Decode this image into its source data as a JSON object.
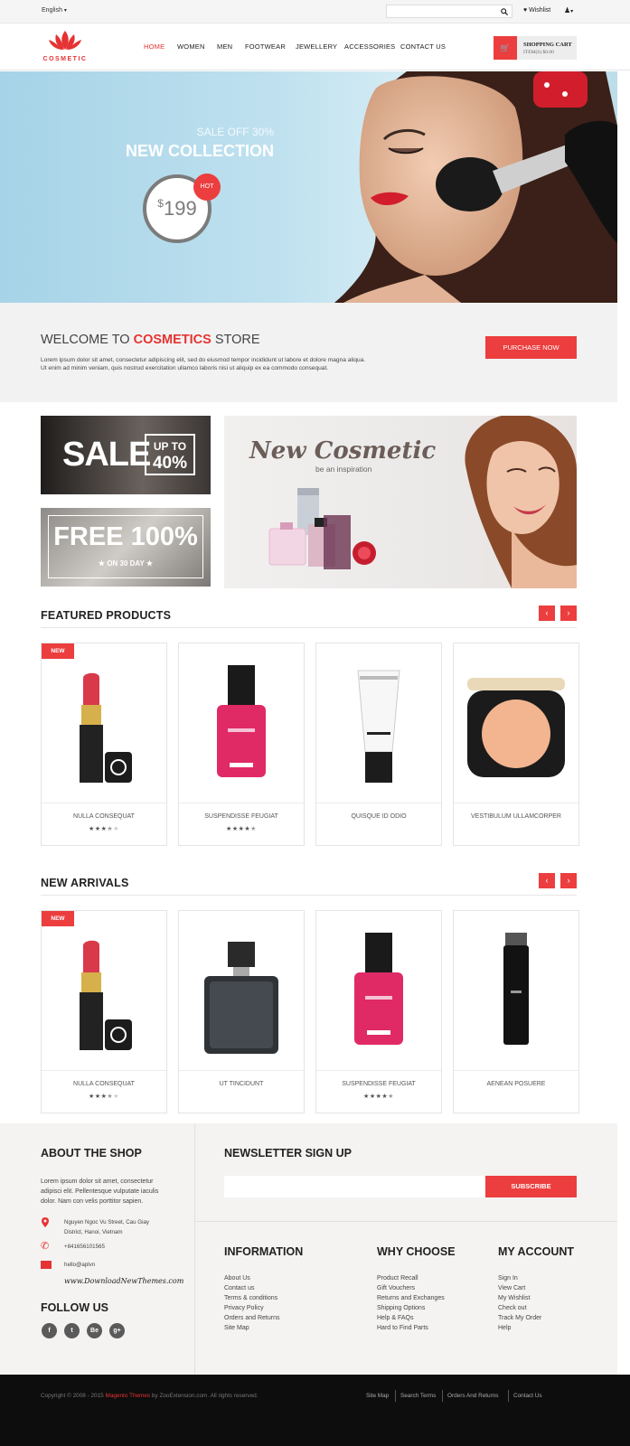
{
  "topbar": {
    "language": "English",
    "wishlist": "Wishlist",
    "search_placeholder": ""
  },
  "header": {
    "logo": "COSMETIC",
    "nav": [
      "HOME",
      "WOMEN",
      "MEN",
      "FOOTWEAR",
      "JEWELLERY",
      "ACCESSORIES",
      "CONTACT US"
    ],
    "cart_title": "SHOPPING CART",
    "cart_info": "ITEM(S) $0.00"
  },
  "hero": {
    "sale": "SALE OFF 30%",
    "title": "NEW COLLECTION",
    "price": "199",
    "currency": "$",
    "badge": "HOT"
  },
  "welcome": {
    "title_pre": "WELCOME TO",
    "title_brand": "COSMETICS",
    "title_post": "STORE",
    "text1": "Lorem ipsum dolor sit amet, consectetur adipiscing elit, sed do eiusmod tempor incididunt ut labore et dolore magna aliqua.",
    "text2": "Ut enim ad minim veniam, quis nostrud exercitation ullamco laboris nisi ut aliquip ex ea commodo consequat.",
    "button": "PURCHASE NOW"
  },
  "banners": {
    "sale_word": "SALE",
    "sale_upto": "UP TO",
    "sale_pct": "40%",
    "free_word": "FREE 100%",
    "free_sub": "ON 30 DAY",
    "newcos_title": "New Cosmetic",
    "newcos_sub": "be an inspiration"
  },
  "featured": {
    "title": "FEATURED PRODUCTS",
    "products": [
      {
        "name": "NULLA CONSEQUAT",
        "badge": "NEW",
        "rating": 3.5,
        "img": "lipstick"
      },
      {
        "name": "SUSPENDISSE FEUGIAT",
        "badge": "",
        "rating": 4.5,
        "img": "nailpolish"
      },
      {
        "name": "QUISQUE ID ODIO",
        "badge": "",
        "rating": 0,
        "img": "cream"
      },
      {
        "name": "VESTIBULUM ULLAMCORPER",
        "badge": "",
        "rating": 0,
        "img": "compact"
      }
    ]
  },
  "arrivals": {
    "title": "NEW ARRIVALS",
    "products": [
      {
        "name": "NULLA CONSEQUAT",
        "badge": "NEW",
        "rating": 3.5,
        "img": "lipstick"
      },
      {
        "name": "UT TINCIDUNT",
        "badge": "",
        "rating": 0,
        "img": "perfume"
      },
      {
        "name": "SUSPENDISSE FEUGIAT",
        "badge": "",
        "rating": 4.5,
        "img": "nailpolish"
      },
      {
        "name": "AENEAN POSUERE",
        "badge": "",
        "rating": 0,
        "img": "spray"
      }
    ]
  },
  "footer": {
    "about_title": "ABOUT THE SHOP",
    "about_text": [
      "Lorem ipsum dolor sit amet, consectetur",
      "adipisci elit. Pellentesque vulputate iaculis",
      "dolor. Nam con velis porttitor sapien."
    ],
    "address": [
      "Nguyen Ngoc Vu Street, Cau Giay",
      "District, Hanoi, Vietnam"
    ],
    "phone": "+841656101565",
    "email": "hello@aplvn",
    "watermark": "www.DownloadNewThemes.com",
    "follow_title": "FOLLOW US",
    "social": [
      "f",
      "t",
      "Be",
      "g+"
    ],
    "newsletter_title": "NEWSLETTER SIGN UP",
    "newsletter_button": "SUBSCRIBE",
    "info_title": "INFORMATION",
    "info_links": [
      "About Us",
      "Contact us",
      "Terms & conditions",
      "Privacy Policy",
      "Orders and Returns",
      "Site Map"
    ],
    "why_title": "WHY CHOOSE",
    "why_links": [
      "Product Recall",
      "Gift Vouchers",
      "Returns and Exchanges",
      "Shipping Options",
      "Help & FAQs",
      "Hard to Find Parts"
    ],
    "acct_title": "MY ACCOUNT",
    "acct_links": [
      "Sign In",
      "View Cart",
      "My Wishlist",
      "Check out",
      "Track My Order",
      "Help"
    ]
  },
  "bottom": {
    "copyright_pre": "Copyright © 2008 - 2015",
    "copyright_brand": "Magento Themes",
    "copyright_post": "by ZooExtension.com. All rights reserved.",
    "links": [
      "Site Map",
      "Search Terms",
      "Orders And Returns",
      "Contact Us"
    ]
  },
  "colors": {
    "accent": "#ec3e3e",
    "hero_bg": "#a9d4e6",
    "footer_bg": "#f4f3f1",
    "bottom_bg": "#0d0d0d"
  }
}
